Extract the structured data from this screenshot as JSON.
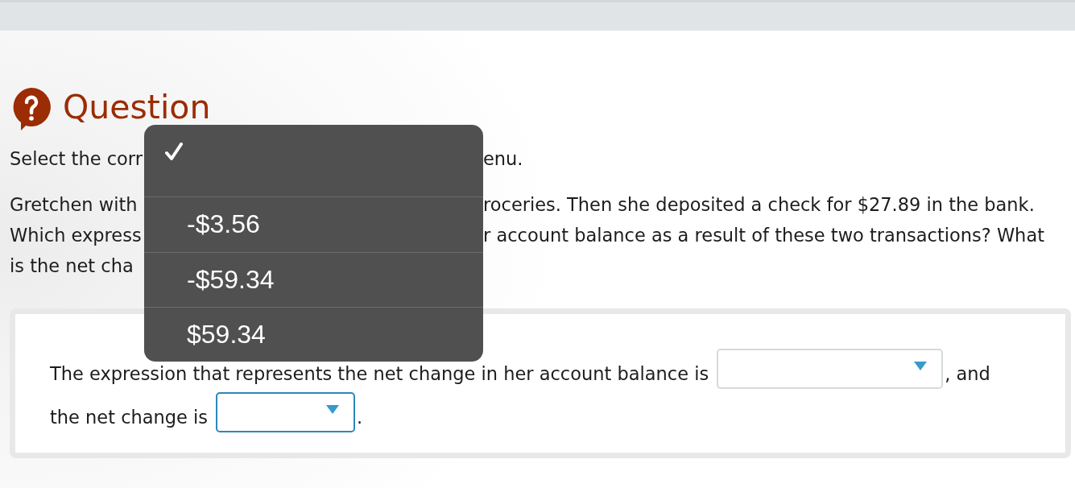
{
  "header": {
    "title": "Question"
  },
  "instruction": {
    "left_part": "Select the corr",
    "right_part": "enu."
  },
  "problem_lines": [
    {
      "left_part": "Gretchen with",
      "right_part": "roceries. Then she deposited a check for $27.89 in the bank."
    },
    {
      "left_part": "Which express",
      "right_part": "r account balance as a result of these two transactions? What"
    },
    {
      "left_part": "is the net cha"
    }
  ],
  "answer_lines": [
    {
      "parts": [
        {
          "kind": "text",
          "text": "The expression that represents the net change in her account balance is"
        },
        {
          "kind": "dropdown",
          "focused": false
        },
        {
          "kind": "text",
          "text": ", and"
        }
      ]
    },
    {
      "parts": [
        {
          "kind": "text",
          "text": "the net change is"
        },
        {
          "kind": "dropdown",
          "focused": true
        },
        {
          "kind": "text",
          "text": "."
        }
      ]
    }
  ],
  "dropdown_menu": {
    "options": [
      {
        "selected": true
      },
      {
        "label": "-$3.56",
        "selected": false
      },
      {
        "label": "-$59.34",
        "selected": false
      },
      {
        "label": "$59.34",
        "selected": false
      }
    ]
  }
}
